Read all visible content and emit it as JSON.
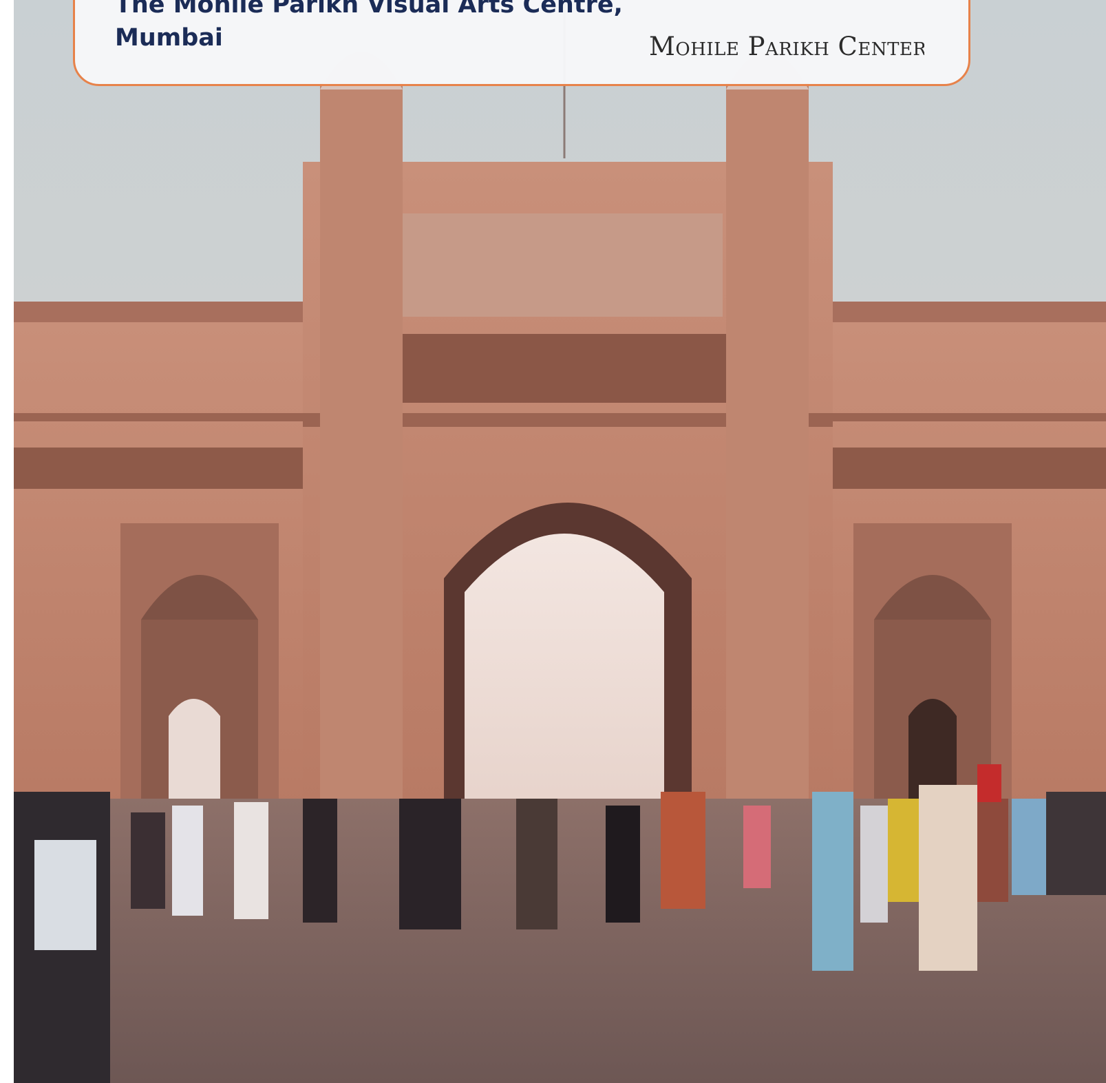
{
  "card": {
    "title_line1": "The Mohile Parikh Visual Arts Centre,",
    "title_line2": "Mumbai",
    "logo_text": "Mohile Parikh Center"
  },
  "colors": {
    "card_border": "#e7824a",
    "title_text": "#1b2c57",
    "logo_blue": "#2f5fa8"
  },
  "photo": {
    "subject": "Gateway of India"
  }
}
